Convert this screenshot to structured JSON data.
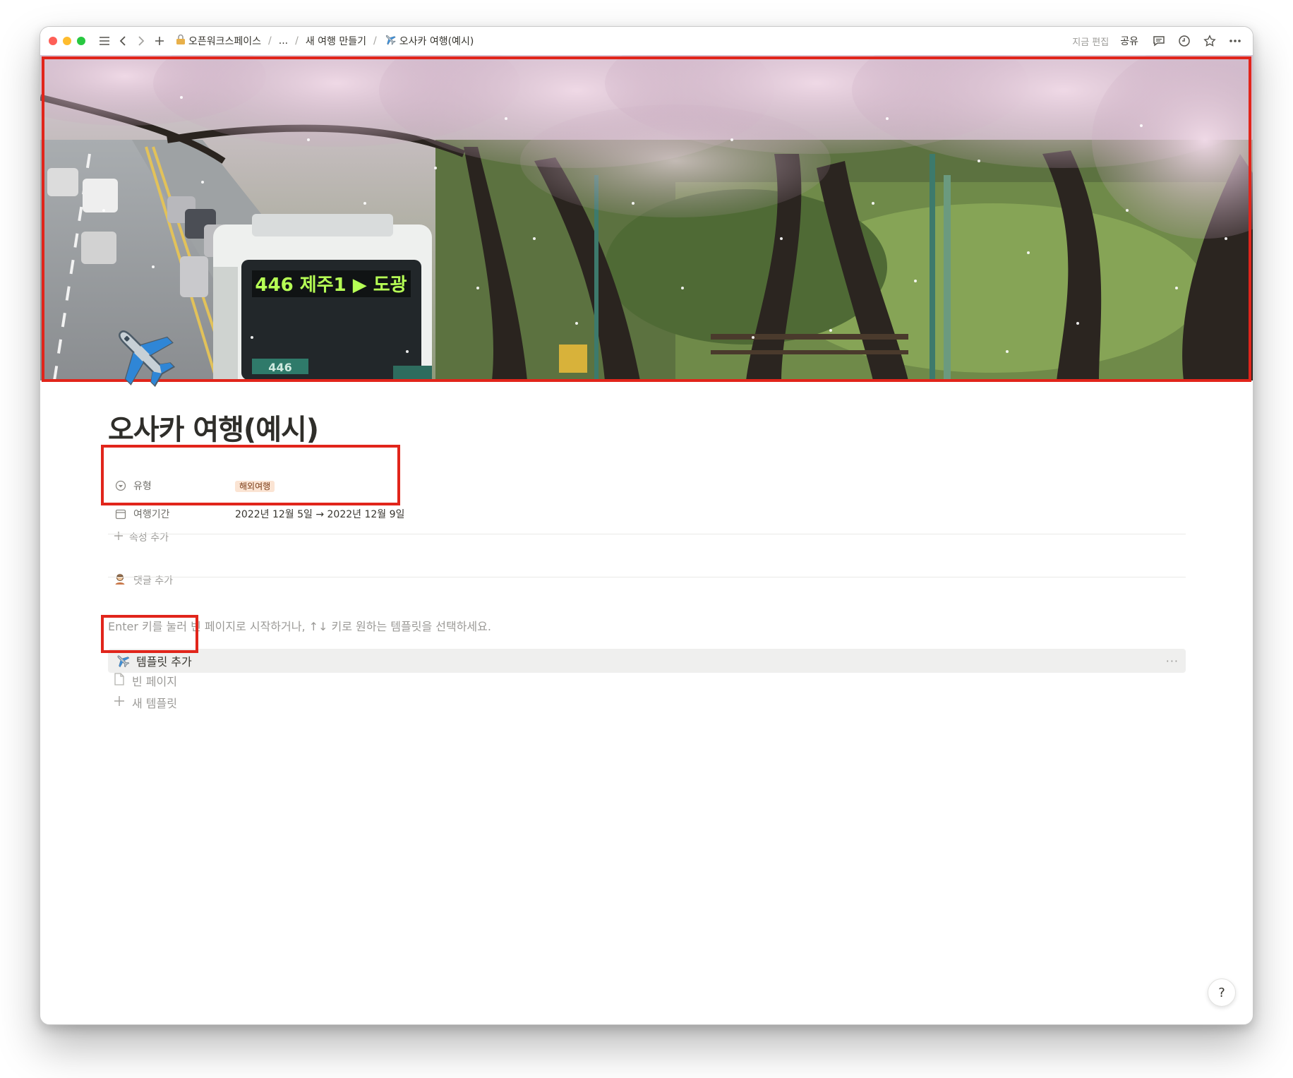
{
  "titlebar": {
    "breadcrumbs": [
      {
        "label": "오픈워크스페이스",
        "icon": "lock-icon"
      },
      {
        "label": "..."
      },
      {
        "label": "새 여행 만들기"
      },
      {
        "label": "오사카 여행(예시)",
        "icon": "airplane-icon"
      }
    ],
    "separator": "/",
    "edited_label": "지금 편집",
    "share_label": "공유"
  },
  "cover": {
    "bus_sign": "446 제주1 ▶ 도광",
    "bus_plate": "446"
  },
  "page": {
    "icon": "airplane-icon",
    "title": "오사카 여행(예시)",
    "properties": [
      {
        "icon": "select-icon",
        "name": "유형",
        "value": "해외여행",
        "type": "tag",
        "tag_color": "#fbe4d3"
      },
      {
        "icon": "calendar-icon",
        "name": "여행기간",
        "value": "2022년 12월 5일 → 2022년 12월 9일",
        "type": "date"
      }
    ],
    "add_property_label": "속성 추가",
    "add_comment_label": "댓글 추가",
    "template_hint": "Enter 키를 눌러 빈 페이지로 시작하거나, ↑↓ 키로 원하는 템플릿을 선택하세요.",
    "templates": [
      {
        "label": "템플릿 추가",
        "icon": "airplane-icon",
        "selected": true,
        "more": "···"
      },
      {
        "label": "빈 페이지",
        "icon": "page-icon"
      },
      {
        "label": "새 템플릿",
        "icon": "plus-icon"
      }
    ]
  },
  "help_label": "?",
  "colors": {
    "highlight": "#e1251b",
    "tag_bg": "#fbe4d3",
    "selected_row_bg": "#efefee"
  }
}
